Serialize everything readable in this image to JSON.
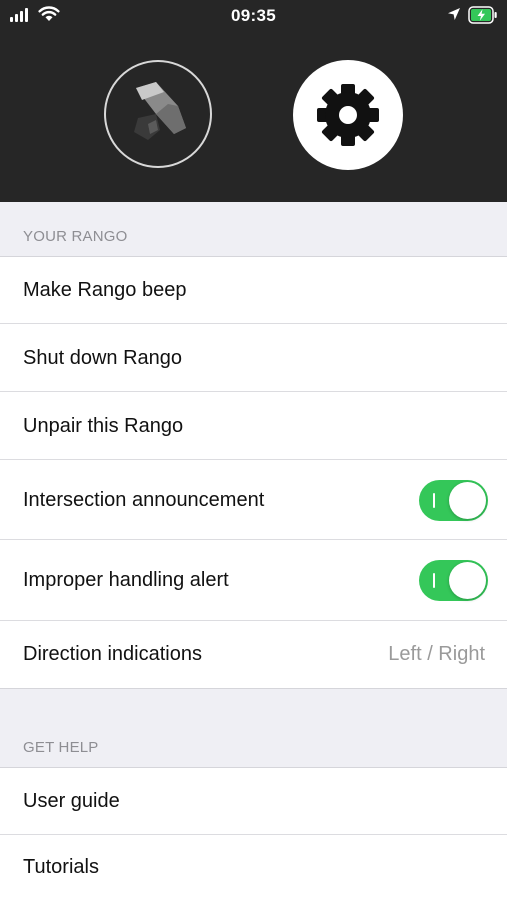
{
  "status_bar": {
    "time": "09:35",
    "icons": [
      "signal-icon",
      "wifi-icon",
      "location-icon",
      "battery-charging-icon"
    ]
  },
  "header": {
    "icons": [
      "rango-device-icon",
      "gear-icon"
    ]
  },
  "sections": {
    "your_rango": {
      "title": "YOUR RANGO",
      "items": [
        {
          "label": "Make Rango beep"
        },
        {
          "label": "Shut down Rango"
        },
        {
          "label": "Unpair this Rango"
        },
        {
          "label": "Intersection announcement",
          "toggle": true
        },
        {
          "label": "Improper handling alert",
          "toggle": true
        },
        {
          "label": "Direction indications",
          "value": "Left / Right"
        }
      ]
    },
    "get_help": {
      "title": "GET HELP",
      "items": [
        {
          "label": "User guide"
        },
        {
          "label": "Tutorials"
        }
      ]
    }
  },
  "colors": {
    "header_bg": "#262626",
    "toggle_on": "#34c759",
    "group_bg": "#efeff4",
    "secondary_text": "#8e8e93"
  }
}
